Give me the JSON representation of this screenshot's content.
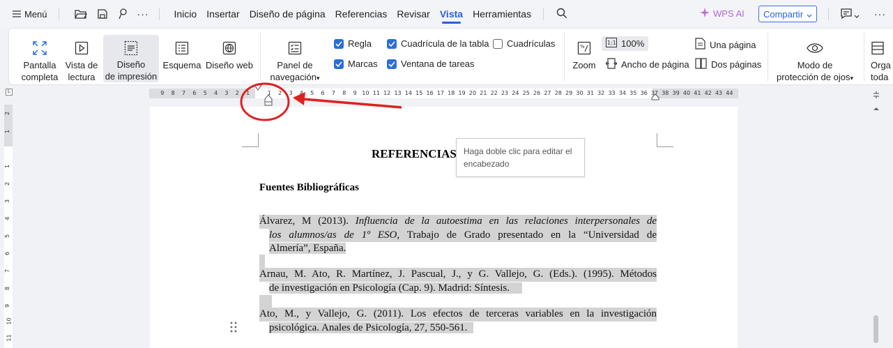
{
  "menubar": {
    "menu_label": "Menú",
    "tabs": [
      "Inicio",
      "Insertar",
      "Diseño de página",
      "Referencias",
      "Revisar",
      "Vista",
      "Herramientas"
    ],
    "active_tab": "Vista",
    "wps_ai": "WPS AI",
    "share": "Compartir"
  },
  "ribbon": {
    "pantalla_completa": [
      "Pantalla",
      "completa"
    ],
    "vista_lectura": [
      "Vista de",
      "lectura"
    ],
    "diseno_impresion": [
      "Diseño",
      "de impresión"
    ],
    "esquema": "Esquema",
    "diseno_web": "Diseño web",
    "panel_navegacion": [
      "Panel de",
      "navegación"
    ],
    "checks": {
      "regla": {
        "label": "Regla",
        "checked": true
      },
      "marcas": {
        "label": "Marcas",
        "checked": true
      },
      "cuadricula_tabla": {
        "label": "Cuadrícula de la tabla",
        "checked": true
      },
      "ventana_tareas": {
        "label": "Ventana de tareas",
        "checked": true
      },
      "cuadriculas": {
        "label": "Cuadrículas",
        "checked": false
      }
    },
    "zoom": "Zoom",
    "zoom_100": "100%",
    "ancho_pagina": "Ancho de página",
    "una_pagina": "Una página",
    "dos_paginas": "Dos páginas",
    "modo_proteccion": [
      "Modo de",
      "protección de ojos"
    ],
    "organizar": [
      "Orga",
      "toda"
    ]
  },
  "ruler": {
    "left_numbers": [
      "9",
      "8",
      "7",
      "6",
      "5",
      "4",
      "3",
      "2",
      "1"
    ],
    "right_numbers": [
      "1",
      "2",
      "3",
      "4",
      "5",
      "6",
      "7",
      "8",
      "9",
      "10",
      "11",
      "12",
      "13",
      "14",
      "15",
      "16",
      "17",
      "18",
      "19",
      "20",
      "21",
      "22",
      "23",
      "24",
      "25",
      "26",
      "27",
      "28",
      "29",
      "30",
      "31",
      "32",
      "33",
      "34",
      "35",
      "36",
      "37",
      "38",
      "39",
      "40",
      "41",
      "42",
      "43",
      "44"
    ],
    "vertical_numbers": [
      "2",
      "1",
      "1",
      "2",
      "3",
      "4",
      "5",
      "6",
      "7",
      "8",
      "9",
      "10",
      "11"
    ]
  },
  "document": {
    "title": "REFERENCIAS",
    "tooltip": "Haga doble clic para editar el encabezado",
    "subheading": "Fuentes Bibliográficas",
    "ref1": {
      "l1_a": "Álvarez, M (2013).  ",
      "l1_b": "Influencia de la autoestima en las relaciones interpersonales de",
      "l2_a": "los alumnos/as de 1º ESO",
      "l2_b": ", Trabajo de Grado presentado en la “Universidad de",
      "l3": "Almería”, España."
    },
    "ref2": {
      "l1": "Arnau, M. Ato, R. Martínez, J. Pascual, J., y G. Vallejo, G. (Eds.). (1995). Métodos",
      "l2": "de investigación en Psicología (Cap. 9). Madrid: Síntesis."
    },
    "ref3": {
      "l1": "Ato, M., y Vallejo, G. (2011). Los efectos de terceras variables en la investigación",
      "l2": "psicológica. Anales de Psicología, 27, 550-561."
    }
  },
  "colors": {
    "accent": "#2b5fd9",
    "checkbox": "#2b6fd8",
    "annotation": "#e02020",
    "highlight": "#d3d3d3"
  }
}
